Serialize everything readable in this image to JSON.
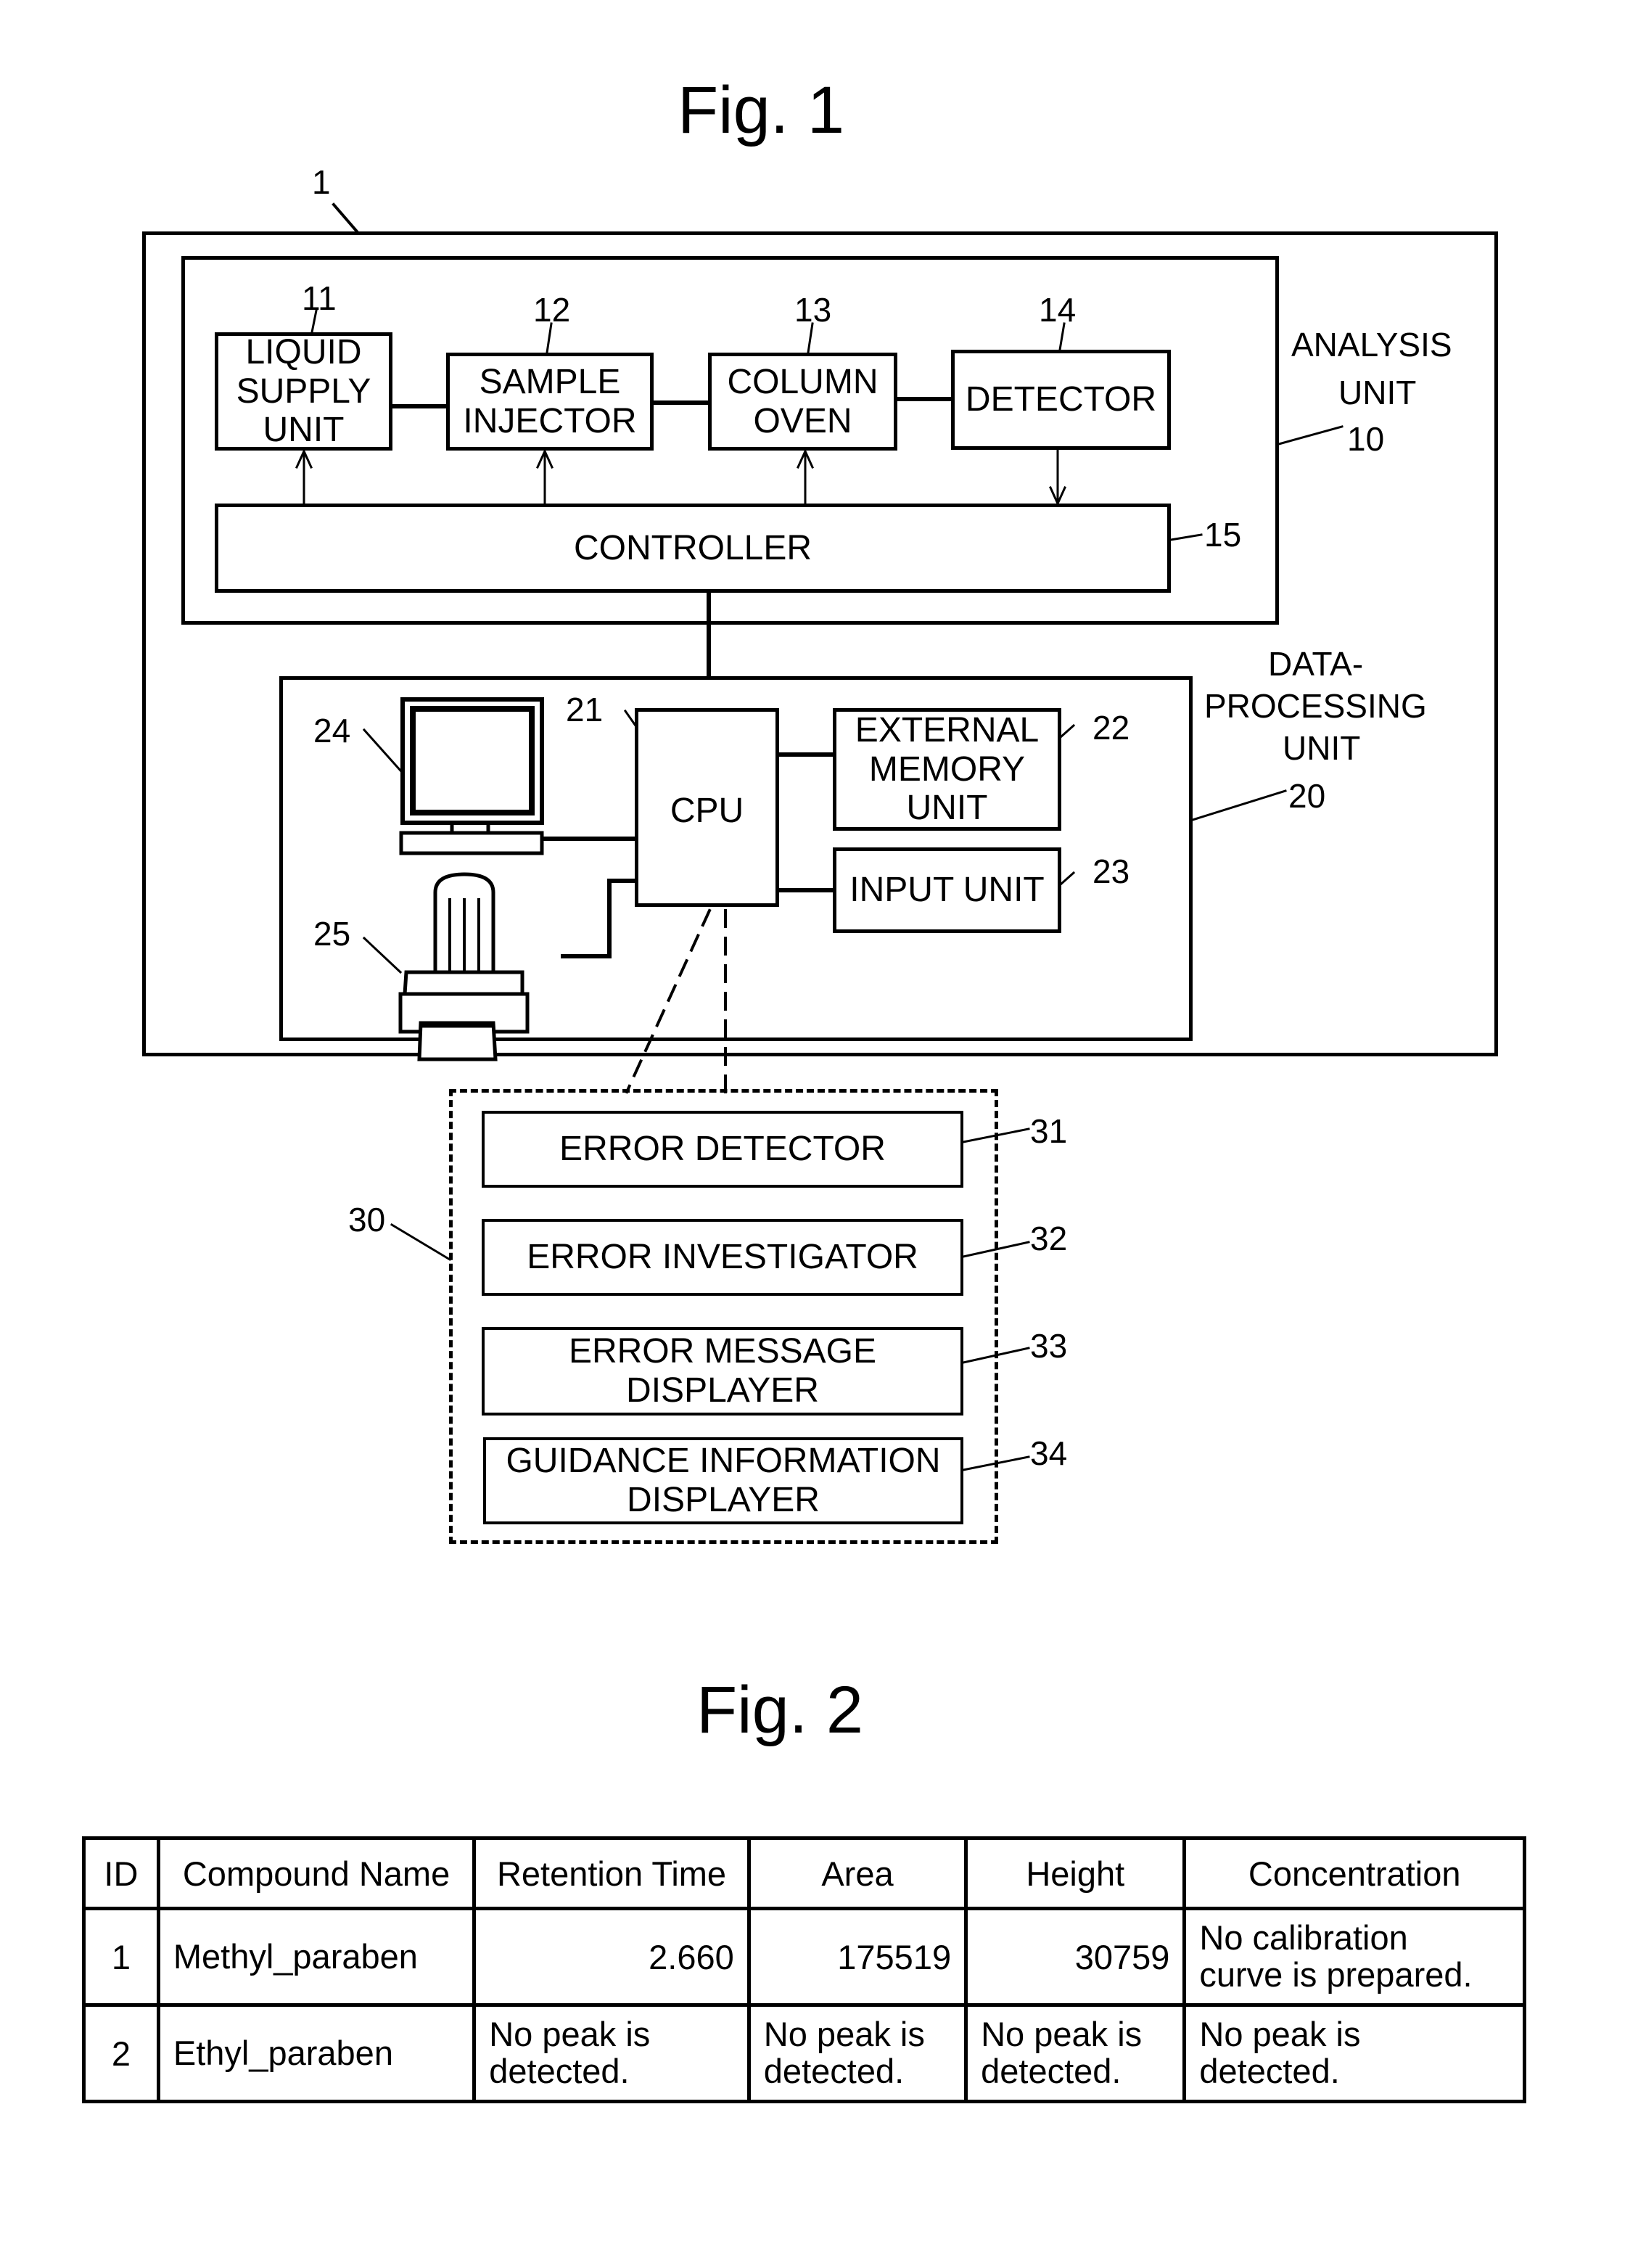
{
  "fig1": {
    "title": "Fig. 1",
    "system_ref": "1",
    "analysis_unit": {
      "label_line1": "ANALYSIS",
      "label_line2": "UNIT",
      "ref": "10",
      "blocks": [
        {
          "ref": "11",
          "lines": [
            "LIQUID",
            "SUPPLY",
            "UNIT"
          ]
        },
        {
          "ref": "12",
          "lines": [
            "SAMPLE",
            "INJECTOR"
          ]
        },
        {
          "ref": "13",
          "lines": [
            "COLUMN",
            "OVEN"
          ]
        },
        {
          "ref": "14",
          "lines": [
            "DETECTOR"
          ]
        }
      ],
      "controller": {
        "ref": "15",
        "label": "CONTROLLER"
      }
    },
    "data_processing_unit": {
      "label_line1": "DATA-",
      "label_line2": "PROCESSING",
      "label_line3": "UNIT",
      "ref": "20",
      "cpu": {
        "ref": "21",
        "label": "CPU"
      },
      "external_memory": {
        "ref": "22",
        "lines": [
          "EXTERNAL",
          "MEMORY",
          "UNIT"
        ]
      },
      "input_unit": {
        "ref": "23",
        "label": "INPUT UNIT"
      },
      "monitor": {
        "ref": "24",
        "icon": "monitor-icon"
      },
      "printer": {
        "ref": "25",
        "icon": "printer-icon"
      }
    },
    "functional_blocks": {
      "ref": "30",
      "items": [
        {
          "ref": "31",
          "lines": [
            "ERROR DETECTOR"
          ]
        },
        {
          "ref": "32",
          "lines": [
            "ERROR INVESTIGATOR"
          ]
        },
        {
          "ref": "33",
          "lines": [
            "ERROR MESSAGE",
            "DISPLAYER"
          ]
        },
        {
          "ref": "34",
          "lines": [
            "GUIDANCE INFORMATION",
            "DISPLAYER"
          ]
        }
      ]
    }
  },
  "fig2": {
    "title": "Fig. 2",
    "table": {
      "headers": [
        "ID",
        "Compound Name",
        "Retention Time",
        "Area",
        "Height",
        "Concentration"
      ],
      "rows": [
        {
          "id": "1",
          "compound": "Methyl_paraben",
          "retention_time": "2.660",
          "area": "175519",
          "height": "30759",
          "concentration_line1": "No calibration",
          "concentration_line2": "curve is prepared."
        },
        {
          "id": "2",
          "compound": "Ethyl_paraben",
          "retention_time_line1": "No peak is",
          "retention_time_line2": "detected.",
          "area_line1": "No peak is",
          "area_line2": "detected.",
          "height_line1": "No peak is",
          "height_line2": "detected.",
          "concentration_line1": "No peak is",
          "concentration_line2": "detected."
        }
      ]
    }
  }
}
